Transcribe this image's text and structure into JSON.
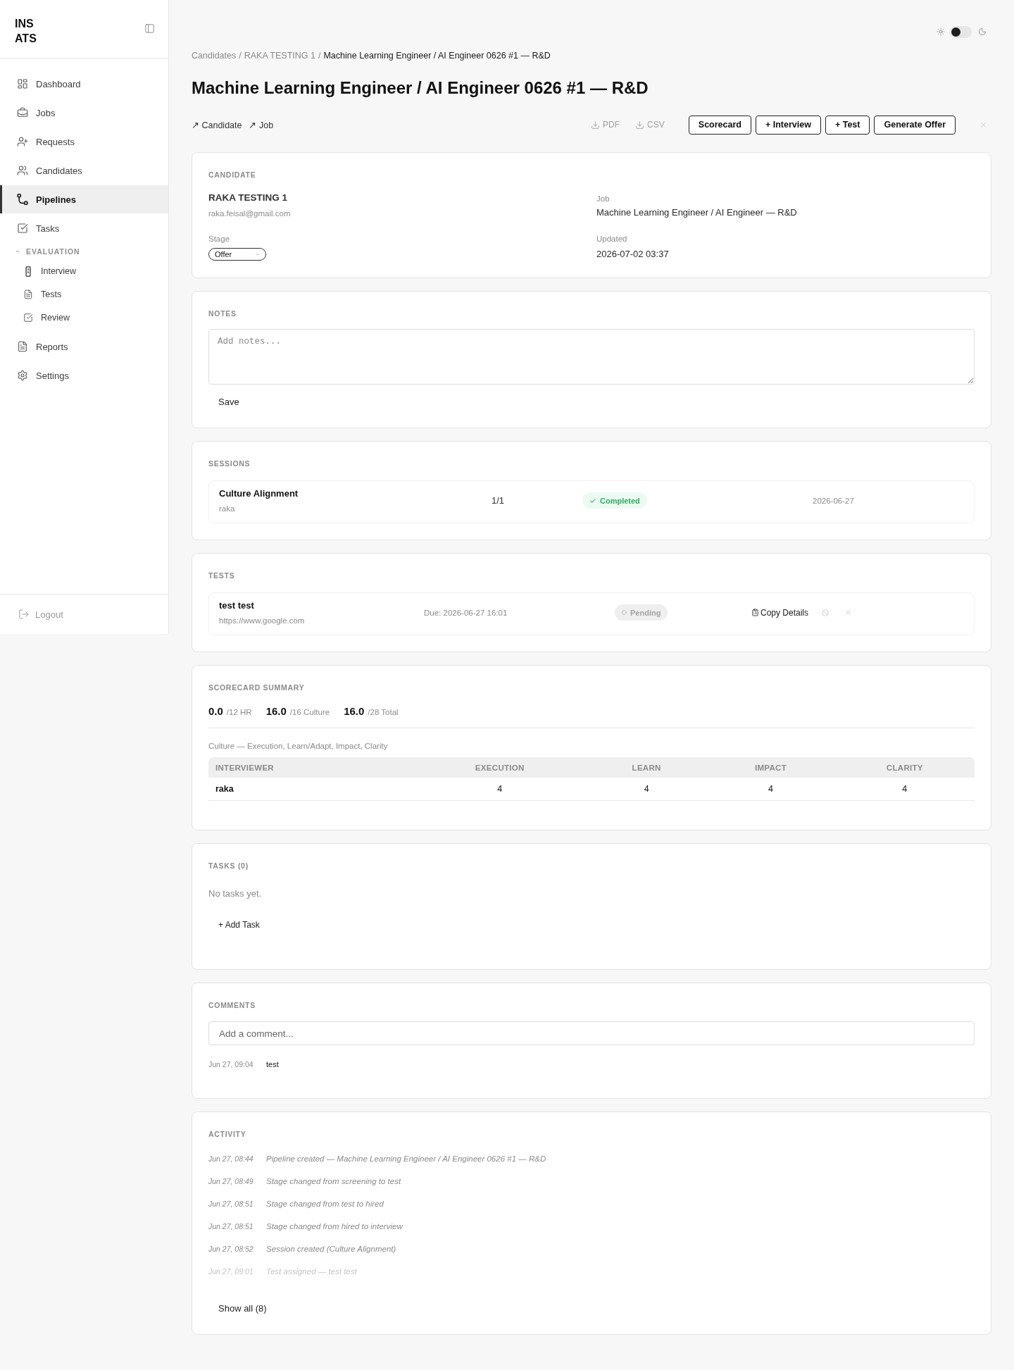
{
  "sidebar": {
    "logo": [
      "INS",
      "ATS"
    ],
    "nav": [
      {
        "kind": "link",
        "label": "Dashboard",
        "selected": false
      },
      {
        "kind": "link",
        "label": "Jobs",
        "selected": false
      },
      {
        "kind": "link",
        "label": "Requests",
        "selected": false
      },
      {
        "kind": "link",
        "label": "Candidates",
        "selected": false
      },
      {
        "kind": "link",
        "label": "Pipelines",
        "selected": true
      },
      {
        "kind": "link",
        "label": "Tasks",
        "selected": false
      },
      {
        "kind": "group",
        "label": "EVALUATION",
        "expanded": true,
        "children": [
          {
            "label": "Interview",
            "selected": false
          },
          {
            "label": "Tests",
            "selected": false
          },
          {
            "label": "Review",
            "selected": false
          }
        ]
      },
      {
        "kind": "link",
        "label": "Reports",
        "selected": false
      },
      {
        "kind": "link",
        "label": "Settings",
        "selected": false
      }
    ],
    "logout": "Logout"
  },
  "theme_toggle": {
    "dark_mode": false
  },
  "breadcrumb": {
    "separator": "/",
    "items": [
      {
        "label": "Candidates",
        "current": false
      },
      {
        "label": "RAKA TESTING 1",
        "current": false
      },
      {
        "label": "Machine Learning Engineer / AI Engineer 0626 #1 — R&D",
        "current": true
      }
    ]
  },
  "title": "Machine Learning Engineer / AI Engineer 0626 #1 — R&D",
  "links": [
    "↗ Candidate",
    "↗ Job"
  ],
  "exports": [
    "PDF",
    "CSV"
  ],
  "actions": [
    "Scorecard",
    "+ Interview",
    "+ Test",
    "Generate Offer"
  ],
  "candidate": {
    "label": "CANDIDATE",
    "name": "RAKA TESTING 1",
    "email": "raka.feisal@gmail.com",
    "stage_label": "Stage",
    "stage": "Offer",
    "job_label": "Job",
    "job": "Machine Learning Engineer / AI Engineer — R&D",
    "updated_label": "Updated",
    "updated": "2026-07-02 03:37"
  },
  "notes": {
    "label": "NOTES",
    "placeholder": "Add notes...",
    "save": "Save"
  },
  "sessions": {
    "label": "SESSIONS",
    "rows": [
      {
        "name": "Culture Alignment",
        "interviewer": "raka",
        "progress": "1/1",
        "status": {
          "label": "Completed",
          "kind": "completed"
        },
        "date": "2026-06-27"
      }
    ]
  },
  "tests": {
    "label": "TESTS",
    "rows": [
      {
        "name": "test test",
        "url": "https://www.google.com",
        "due": "Due: 2026-06-27 16:01",
        "status": {
          "label": "Pending",
          "kind": "pending"
        },
        "copy": "Copy Details"
      }
    ]
  },
  "scorecard": {
    "label": "SCORECARD SUMMARY",
    "scores": [
      {
        "value": "0.0",
        "total": "/12 HR"
      },
      {
        "value": "16.0",
        "total": "/16 Culture"
      },
      {
        "value": "16.0",
        "total": "/28 Total"
      }
    ],
    "caption": "Culture — Execution, Learn/Adapt, Impact, Clarity",
    "columns": [
      "INTERVIEWER",
      "EXECUTION",
      "LEARN",
      "IMPACT",
      "CLARITY"
    ],
    "rows": [
      [
        "raka",
        "4",
        "4",
        "4",
        "4"
      ]
    ]
  },
  "tasks": {
    "label": "TASKS (0)",
    "empty": "No tasks yet.",
    "add": "+ Add Task"
  },
  "comments": {
    "label": "COMMENTS",
    "placeholder": "Add a comment...",
    "items": [
      {
        "time": "Jun 27, 09:04",
        "text": "test"
      }
    ]
  },
  "activity": {
    "label": "ACTIVITY",
    "items": [
      {
        "time": "Jun 27, 08:44",
        "text": "Pipeline created — Machine Learning Engineer / AI Engineer 0626 #1 — R&D",
        "faded": false
      },
      {
        "time": "Jun 27, 08:49",
        "text": "Stage changed from screening to test",
        "faded": false
      },
      {
        "time": "Jun 27, 08:51",
        "text": "Stage changed from test to hired",
        "faded": false
      },
      {
        "time": "Jun 27, 08:51",
        "text": "Stage changed from hired to interview",
        "faded": false
      },
      {
        "time": "Jun 27, 08:52",
        "text": "Session created (Culture Alignment)",
        "faded": false
      },
      {
        "time": "Jun 27, 09:01",
        "text": "Test assigned — test test",
        "faded": true
      }
    ],
    "show_all": "Show all (8)"
  }
}
